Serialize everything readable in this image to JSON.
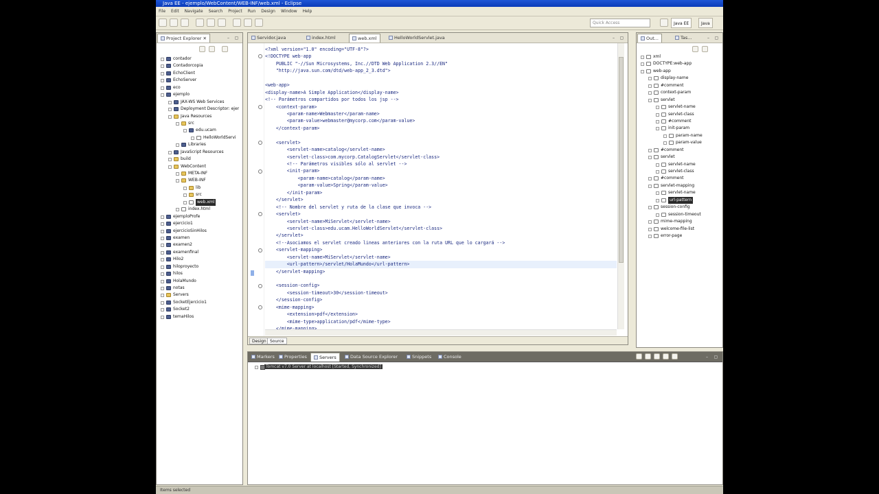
{
  "window": {
    "title": "Java EE - ejemplo/WebContent/WEB-INF/web.xml - Eclipse"
  },
  "menubar": {
    "items": [
      "File",
      "Edit",
      "Navigate",
      "Search",
      "Project",
      "Run",
      "Design",
      "Window",
      "Help"
    ]
  },
  "toolbar": {
    "quick_access_placeholder": "Quick Access",
    "perspectives": [
      "Java EE",
      "Java"
    ]
  },
  "project_explorer": {
    "tab_label": "Project Explorer",
    "items": [
      {
        "label": "contador",
        "depth": 0,
        "kind": "project"
      },
      {
        "label": "Contadorcopia",
        "depth": 0,
        "kind": "project"
      },
      {
        "label": "EchoClient",
        "depth": 0,
        "kind": "project"
      },
      {
        "label": "EchoServer",
        "depth": 0,
        "kind": "project"
      },
      {
        "label": "eco",
        "depth": 0,
        "kind": "project"
      },
      {
        "label": "ejemplo",
        "depth": 0,
        "kind": "project"
      },
      {
        "label": "JAX-WS Web Services",
        "depth": 1,
        "kind": "project"
      },
      {
        "label": "Deployment Descriptor: ejer",
        "depth": 1,
        "kind": "project"
      },
      {
        "label": "Java Resources",
        "depth": 1,
        "kind": "folder"
      },
      {
        "label": "src",
        "depth": 2,
        "kind": "folder"
      },
      {
        "label": "edu.ucam",
        "depth": 3,
        "kind": "project"
      },
      {
        "label": "HelloWorldServi",
        "depth": 4,
        "kind": "file"
      },
      {
        "label": "Libraries",
        "depth": 2,
        "kind": "project"
      },
      {
        "label": "JavaScript Resources",
        "depth": 1,
        "kind": "project"
      },
      {
        "label": "build",
        "depth": 1,
        "kind": "folder"
      },
      {
        "label": "WebContent",
        "depth": 1,
        "kind": "folder"
      },
      {
        "label": "META-INF",
        "depth": 2,
        "kind": "folder"
      },
      {
        "label": "WEB-INF",
        "depth": 2,
        "kind": "folder"
      },
      {
        "label": "lib",
        "depth": 3,
        "kind": "folder"
      },
      {
        "label": "src",
        "depth": 3,
        "kind": "folder"
      },
      {
        "label": "web.xml",
        "depth": 3,
        "kind": "file",
        "selected": true
      },
      {
        "label": "index.html",
        "depth": 2,
        "kind": "file"
      },
      {
        "label": "ejemploProfe",
        "depth": 0,
        "kind": "project"
      },
      {
        "label": "ejercicio1",
        "depth": 0,
        "kind": "project"
      },
      {
        "label": "ejercicioSinHilos",
        "depth": 0,
        "kind": "project"
      },
      {
        "label": "examen",
        "depth": 0,
        "kind": "project"
      },
      {
        "label": "examen2",
        "depth": 0,
        "kind": "project"
      },
      {
        "label": "examenfinal",
        "depth": 0,
        "kind": "project"
      },
      {
        "label": "Hilo2",
        "depth": 0,
        "kind": "project"
      },
      {
        "label": "hiloproyecto",
        "depth": 0,
        "kind": "project"
      },
      {
        "label": "hilos",
        "depth": 0,
        "kind": "project"
      },
      {
        "label": "HolaMundo",
        "depth": 0,
        "kind": "project"
      },
      {
        "label": "notas",
        "depth": 0,
        "kind": "project"
      },
      {
        "label": "Servers",
        "depth": 0,
        "kind": "folder"
      },
      {
        "label": "SocketEjercicio1",
        "depth": 0,
        "kind": "project"
      },
      {
        "label": "Socket2",
        "depth": 0,
        "kind": "project"
      },
      {
        "label": "temaHilos",
        "depth": 0,
        "kind": "project"
      }
    ]
  },
  "editor": {
    "tabs": [
      {
        "label": "Servidor.java",
        "active": false
      },
      {
        "label": "index.html",
        "active": false
      },
      {
        "label": "web.xml",
        "active": true
      },
      {
        "label": "HelloWorldServlet.java",
        "active": false
      }
    ],
    "lines": [
      "<?xml version=\"1.0\" encoding=\"UTF-8\"?>",
      "<!DOCTYPE web-app",
      "    PUBLIC \"-//Sun Microsystems, Inc.//DTD Web Application 2.3//EN\"",
      "    \"http://java.sun.com/dtd/web-app_2_3.dtd\">",
      "",
      "<web-app>",
      "<display-name>A Simple Application</display-name>",
      "<!-- Parámetros compartidos por todos los jsp -->",
      "    <context-param>",
      "        <param-name>Webmaster</param-name>",
      "        <param-value>webmaster@mycorp.com</param-value>",
      "    </context-param>",
      "",
      "    <servlet>",
      "        <servlet-name>catalog</servlet-name>",
      "        <servlet-class>com.mycorp.CatalogServlet</servlet-class>",
      "        <!-- Parámetros visibles sólo al servlet -->",
      "        <init-param>",
      "            <param-name>catalog</param-name>",
      "            <param-value>Spring</param-value>",
      "        </init-param>",
      "    </servlet>",
      "    <!-- Nombre del servlet y ruta de la clase que invoca -->",
      "    <servlet>",
      "        <servlet-name>MiServlet</servlet-name>",
      "        <servlet-class>edu.ucam.HelloWorldServlet</servlet-class>",
      "    </servlet>",
      "    <!--Asociamos el servlet creado lineas anteriores con la ruta URL que lo cargará -->",
      "    <servlet-mapping>",
      "        <servlet-name>MiServlet</servlet-name>",
      "        <url-pattern>/servlet/HolaMundo</url-pattern>",
      "    </servlet-mapping>",
      "",
      "    <session-config>",
      "        <session-timeout>30</session-timeout>",
      "    </session-config>",
      "    <mime-mapping>",
      "        <extension>pdf</extension>",
      "        <mime-type>application/pdf</mime-type>",
      "    </mime-mapping>"
    ],
    "bottom_tabs": [
      "Design",
      "Source"
    ]
  },
  "outline": {
    "tabs": [
      "Out...",
      "Tas..."
    ],
    "items": [
      {
        "label": "xml",
        "depth": 0
      },
      {
        "label": "DOCTYPE:web-app",
        "depth": 0
      },
      {
        "label": "web-app",
        "depth": 0
      },
      {
        "label": "display-name",
        "depth": 1
      },
      {
        "label": "#comment",
        "depth": 1
      },
      {
        "label": "context-param",
        "depth": 1
      },
      {
        "label": "servlet",
        "depth": 1
      },
      {
        "label": "servlet-name",
        "depth": 2
      },
      {
        "label": "servlet-class",
        "depth": 2
      },
      {
        "label": "#comment",
        "depth": 2
      },
      {
        "label": "init-param",
        "depth": 2
      },
      {
        "label": "param-name",
        "depth": 3
      },
      {
        "label": "param-value",
        "depth": 3
      },
      {
        "label": "#comment",
        "depth": 1
      },
      {
        "label": "servlet",
        "depth": 1
      },
      {
        "label": "servlet-name",
        "depth": 2
      },
      {
        "label": "servlet-class",
        "depth": 2
      },
      {
        "label": "#comment",
        "depth": 1
      },
      {
        "label": "servlet-mapping",
        "depth": 1
      },
      {
        "label": "servlet-name",
        "depth": 2
      },
      {
        "label": "url-pattern",
        "depth": 2,
        "selected": true
      },
      {
        "label": "session-config",
        "depth": 1
      },
      {
        "label": "session-timeout",
        "depth": 2
      },
      {
        "label": "mime-mapping",
        "depth": 1
      },
      {
        "label": "welcome-file-list",
        "depth": 1
      },
      {
        "label": "error-page",
        "depth": 1
      }
    ]
  },
  "bottom_panel": {
    "tabs": [
      {
        "label": "Markers",
        "active": false
      },
      {
        "label": "Properties",
        "active": false
      },
      {
        "label": "Servers",
        "active": true
      },
      {
        "label": "Data Source Explorer",
        "active": false
      },
      {
        "label": "Snippets",
        "active": false
      },
      {
        "label": "Console",
        "active": false
      }
    ],
    "server_entry": "Tomcat v7.0 Server at localhost [Started, Synchronized]"
  },
  "statusbar": {
    "text": "Items selected"
  },
  "colors": {
    "selection": "#2a2a2a",
    "tag": "#3b7fa6",
    "comment": "#3f5fbf",
    "current_line": "#e8f0fc",
    "titlebar": "#0a3bb8"
  }
}
